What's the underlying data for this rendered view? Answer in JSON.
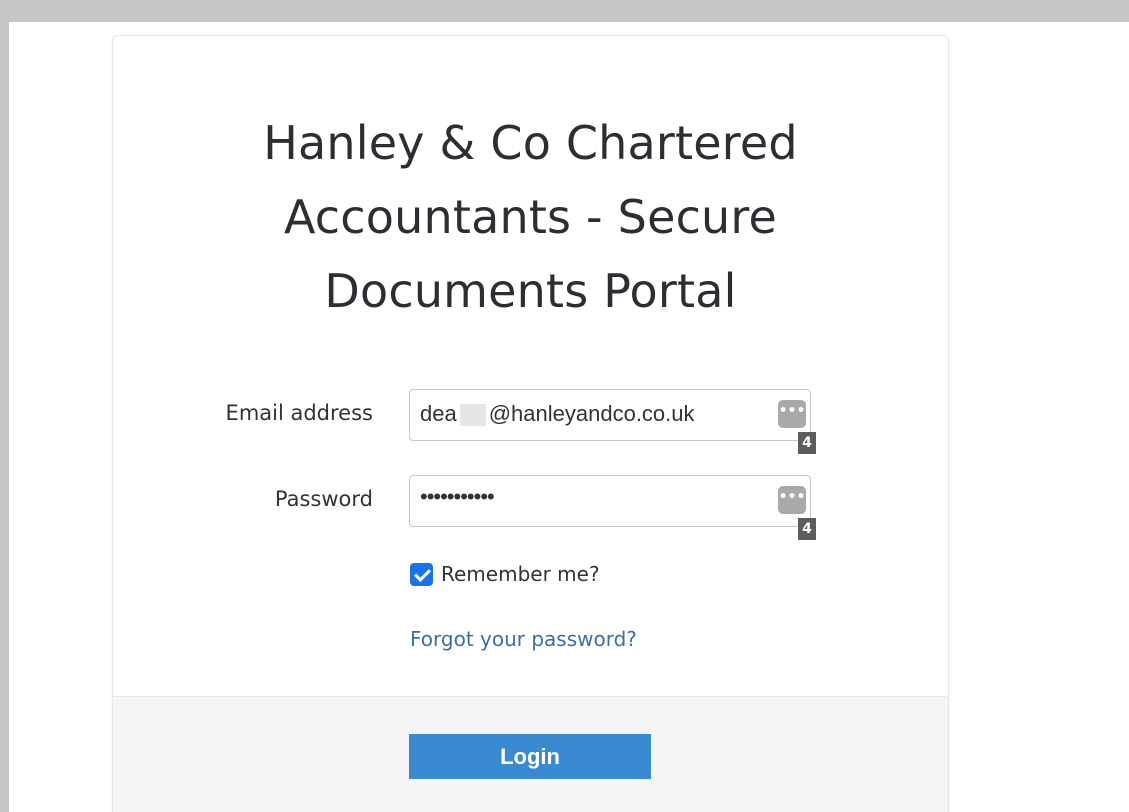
{
  "portal": {
    "title": "Hanley & Co Chartered Accountants - Secure Documents Portal"
  },
  "form": {
    "email_label": "Email address",
    "email_value_prefix": "dea",
    "email_value_suffix": "@hanleyandco.co.uk",
    "password_label": "Password",
    "password_masked": "•••••••••••",
    "password_manager_badge": "4",
    "password_manager_icon": "more-dots-icon",
    "remember_label": "Remember me?",
    "remember_checked": true,
    "forgot_link": "Forgot your password?",
    "login_label": "Login"
  },
  "colors": {
    "accent": "#3a8ad1",
    "link": "#3b6ea5",
    "checkbox": "#1a73e8"
  }
}
